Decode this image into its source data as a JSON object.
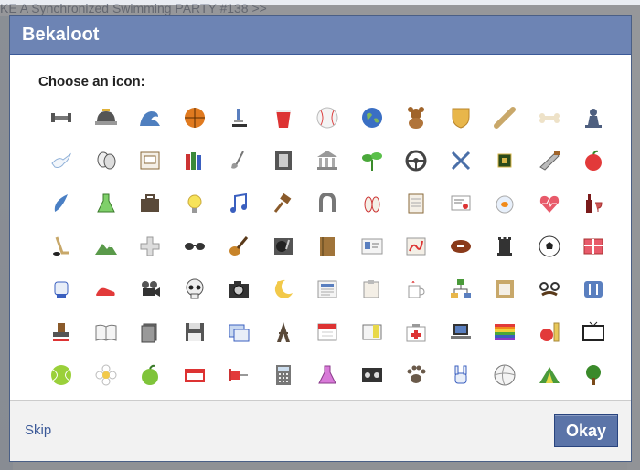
{
  "background": {
    "page_text": "KE A Synchronized Swimming PARTY #138 >>"
  },
  "dialog": {
    "title": "Bekaloot",
    "prompt": "Choose an icon:",
    "skip_label": "Skip",
    "okay_label": "Okay"
  },
  "colors": {
    "header": "#6d84b4",
    "button": "#5b74a8",
    "link": "#3b5998"
  },
  "icons": [
    [
      "dumbbell",
      "hard-hat",
      "wave",
      "basketball",
      "microscope",
      "red-cup",
      "baseball",
      "globe",
      "teddy-bear",
      "shield",
      "skateboard",
      "bone",
      "chess-pawn"
    ],
    [
      "dove",
      "theater-masks",
      "inbox-tray",
      "books",
      "golf-club",
      "film-strip",
      "museum",
      "sprout",
      "steering-wheel",
      "crossed-swords",
      "circuit-chip",
      "saw",
      "apple-red"
    ],
    [
      "feather-quill",
      "flask-green",
      "briefcase",
      "light-bulb",
      "music-notes",
      "gavel",
      "horseshoe",
      "bowling-pins",
      "notebook",
      "certificate",
      "goldfish-bowl",
      "heartbeat",
      "wine-bottle"
    ],
    [
      "hockey-stick",
      "mountains",
      "medical-cross",
      "sunglasses",
      "guitar",
      "turntable",
      "book-brown",
      "id-card",
      "map-route",
      "football",
      "chess-rook",
      "soccer-ball",
      "gift-card"
    ],
    [
      "fist",
      "sneaker",
      "movie-camera",
      "skull",
      "camera",
      "moon-star",
      "newspaper",
      "document-clip",
      "coffee-mug",
      "org-chart",
      "picture-frame",
      "disguise-glasses",
      "fork-knife"
    ],
    [
      "rubber-stamp",
      "open-book",
      "pages-gray",
      "floppy-disk",
      "windows",
      "eiffel-tower",
      "calendar",
      "receipt",
      "first-aid-kit",
      "laptop",
      "rainbow-flag",
      "apple-ruler",
      "television"
    ],
    [
      "tennis-ball",
      "flower",
      "apple-green",
      "name-tag",
      "pushpin",
      "calculator",
      "flask-purple",
      "cassette",
      "paw-print",
      "rock-hand",
      "volleyball",
      "tent",
      "tree"
    ]
  ]
}
